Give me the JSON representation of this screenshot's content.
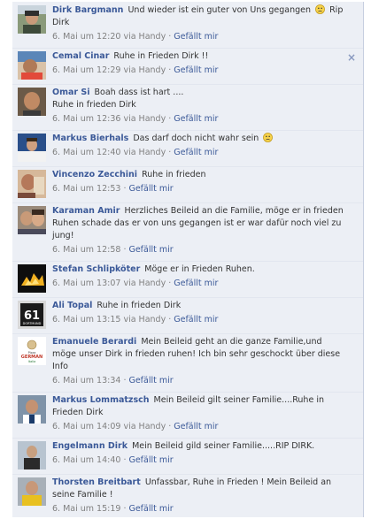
{
  "comments": [
    {
      "author": "Dirk Bargmann",
      "text_before": "Und wieder ist ein guter von Uns gegangen",
      "emoticon": "sad-face",
      "text_after": "Rip Dirk",
      "time": "6. Mai um 12:20 via Handy",
      "like_label": "Gefällt mir"
    },
    {
      "author": "Cemal Cinar",
      "text": "Ruhe in Frieden Dirk !!",
      "time": "6. Mai um 12:29 via Handy",
      "like_label": "Gefällt mir",
      "close_glyph": "×"
    },
    {
      "author": "Omar Si",
      "text": "Boah dass ist hart ....\nRuhe in frieden Dirk",
      "time": "6. Mai um 12:36 via Handy",
      "like_label": "Gefällt mir"
    },
    {
      "author": "Markus Bierhals",
      "text_before": "Das darf doch nicht wahr sein",
      "emoticon": "sad-face",
      "time": "6. Mai um 12:40 via Handy",
      "like_label": "Gefällt mir"
    },
    {
      "author": "Vincenzo Zecchini",
      "text": "Ruhe in frieden",
      "time": "6. Mai um 12:53",
      "like_label": "Gefällt mir"
    },
    {
      "author": "Karaman Amir",
      "text": "Herzliches Beileid an die Familie, möge er in frieden Ruhen schade das er von uns gegangen ist er war dafür noch viel zu jung!",
      "time": "6. Mai um 12:58",
      "like_label": "Gefällt mir"
    },
    {
      "author": "Stefan Schlipköter",
      "text": "Möge er in Frieden Ruhen.",
      "time": "6. Mai um 13:07 via Handy",
      "like_label": "Gefällt mir"
    },
    {
      "author": "Ali Topal",
      "text": "Ruhe in frieden Dirk",
      "time": "6. Mai um 13:15 via Handy",
      "like_label": "Gefällt mir"
    },
    {
      "author": "Emanuele Berardi",
      "text": "Mein Beileid geht an die ganze Familie,und möge unser Dirk in frieden ruhen! Ich bin sehr geschockt über diese Info",
      "time": "6. Mai um 13:34",
      "like_label": "Gefällt mir"
    },
    {
      "author": "Markus Lommatzsch",
      "text": "Mein Beileid gilt seiner Familie....Ruhe in Frieden Dirk",
      "time": "6. Mai um 14:09 via Handy",
      "like_label": "Gefällt mir"
    },
    {
      "author": "Engelmann Dirk",
      "text": "Mein Beileid gild seiner Familie.....RIP DIRK.",
      "time": "6. Mai um 14:40",
      "like_label": "Gefällt mir"
    },
    {
      "author": "Thorsten Breitbart",
      "text": "Unfassbar, Ruhe in Frieden ! Mein Beileid an seine Familie !",
      "time": "6. Mai um 15:19",
      "like_label": "Gefällt mir"
    }
  ],
  "avatar_badges": {
    "ali_topal_number": "61",
    "ali_topal_caption": "DORTMUND",
    "emanuele_caption_top": "Pizza",
    "emanuele_caption_mid": "GERMAN",
    "emanuele_caption_bottom": "Italia"
  },
  "colors": {
    "link_blue": "#3b5998",
    "comment_bg": "#eceff5",
    "meta_gray": "#808080"
  }
}
